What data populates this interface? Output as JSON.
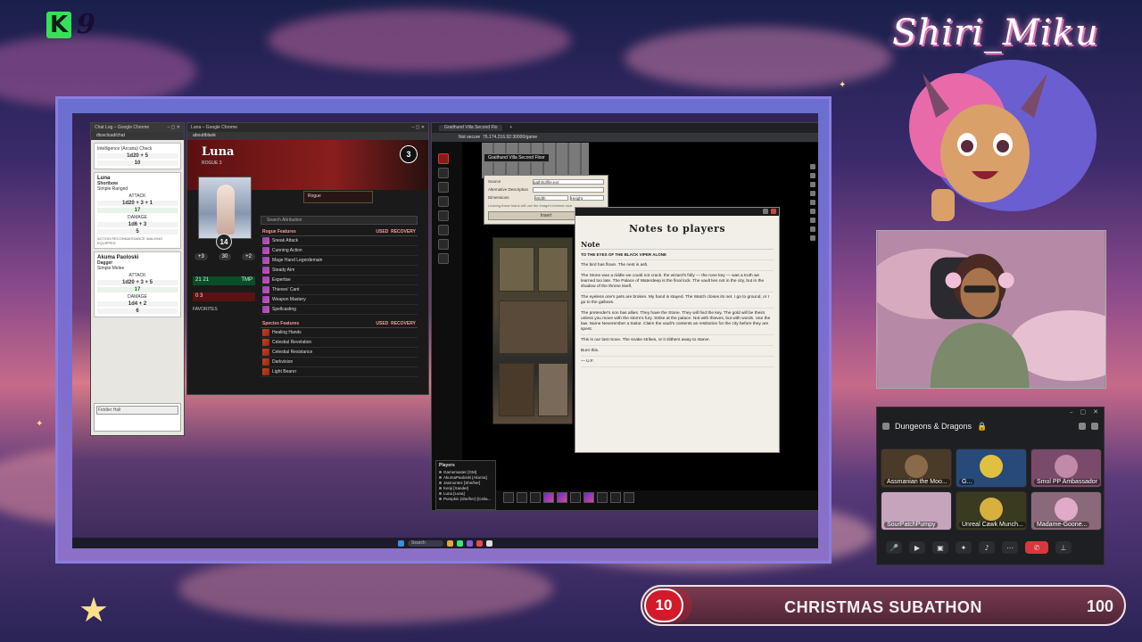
{
  "overlay": {
    "logo_letter": "K",
    "logo_number": "9",
    "streamer_name": "Shiri_Miku",
    "subathon": {
      "title": "CHRISTMAS SUBATHON",
      "current": "10",
      "goal": "100",
      "progress_fraction": 0.1,
      "accent": "#d21b2a"
    }
  },
  "chat_log": {
    "window_title": "Chat Log – Google Chrome",
    "url": "dicecloud/chat",
    "subtitle": "Intelligence (Arcana) Check",
    "first_roll": "1d20 + 5",
    "first_total": "10",
    "cards": [
      {
        "name": "Luna",
        "action": "Shortbow",
        "sub": "Simple Ranged",
        "attack_label": "ATTACK",
        "attack_formula": "1d20 + 3 + 1",
        "attack_total": "17",
        "damage_label": "DAMAGE",
        "damage_formula": "1d6 + 3",
        "damage_total": "5"
      },
      {
        "name": "Akuma Paoloski",
        "action": "Dagger",
        "sub": "Simple Melee",
        "attack_label": "ATTACK",
        "attack_formula": "1d20 + 3 + 5",
        "attack_total": "17",
        "damage_label": "DAMAGE",
        "damage_formula": "1d4 + 2",
        "damage_total": "6"
      }
    ],
    "tag_row": "ACTION   RECONNAISSANCE   WALKING   EQUIPPED",
    "select_value": "Fiddler Hall"
  },
  "sheet": {
    "window_title": "Luna – Google Chrome",
    "url": "abouttblank",
    "name": "Luna",
    "class_level": "ROGUE 3",
    "level": "3",
    "ac": "14",
    "stats": [
      "+3",
      "30",
      "+2"
    ],
    "hp": "21  21",
    "hp_extra": "TMP",
    "hit_dice": "0  3",
    "background_item": "Rogue",
    "search_placeholder": "Search Attribution",
    "favorites": "FAVORITES",
    "rogue_features_title": "Rogue Features",
    "col_used": "USED",
    "col_recovery": "RECOVERY",
    "rogue_features": [
      "Sneak Attack",
      "Cunning Action",
      "Mage Hand Legerdemain",
      "Steady Aim",
      "Expertise",
      "Thieves' Cant",
      "Weapon Mastery",
      "Spellcasting"
    ],
    "species_features_title": "Species Features",
    "species_features": [
      "Healing Hands",
      "Celestial Revelation",
      "Celestial Resistance",
      "Darkvision",
      "Light Bearer"
    ]
  },
  "foundry": {
    "tab_title": "Graithund Villa Second Flo",
    "url": "76.174.216.92:30000/game",
    "not_secure": "Not secure",
    "scene_title": "Graithund Villa Second Floor",
    "image_dialog": {
      "source_label": "Source",
      "source_value": "path/to/file.ext",
      "alt_label": "Alternative Description",
      "dim_label": "Dimensions",
      "width_label": "Width",
      "height_label": "Height",
      "hint": "Leaving these blank will use the image's intrinsic size.",
      "button": "Insert"
    },
    "notes": {
      "title": "Notes to players",
      "heading": "Note",
      "addressee": "TO THE EYES OF THE BLACK VIPER ALONE",
      "paragraphs": [
        "The bird has flown. The nest is ash.",
        "The Stone was a riddle we could not crack. the wizard's folly — the rune key — was a truth we learned too late. The Palace of Waterdeep is the final lock. The vault lies not in the city, but in the shadow of the throne itself.",
        "The eyeless one's pets are broken. My hand is stayed. The Watch closes its net. I go to ground, or I go to the gallows.",
        "The pretender's son has allies. They have the Stone. They will find the key. The gold will be theirs unless you move with the storm's fury. Strike at the palace. Not with thieves, but with words. Use the law. Name Neverember a traitor. Claim the vault's contents as restitution for the city before they are spent.",
        "This is our last move. The snake strikes, or it slithers away to starve.",
        "Burn this.",
        "— U.F."
      ]
    },
    "players_title": "Players",
    "players": [
      "Gamemaster [GM]",
      "AkumaPaoloski [Akuma]",
      "Jasmontez [She/her]",
      "Kenji [Xander]",
      "Luna [Luna]",
      "Pumpkin (she/her) [Celia..."
    ]
  },
  "discord": {
    "channel": "Dungeons & Dragons",
    "lock_icon": "lock-icon",
    "participants": [
      {
        "name": "Assmanian the Moo...",
        "color": "#4a3a28"
      },
      {
        "name": "G...",
        "color": "#274a7a"
      },
      {
        "name": "Smol PP Ambassador",
        "color": "#7a4a6a"
      },
      {
        "name": "SourPatchPumpy",
        "color": "#c6a4bc"
      },
      {
        "name": "Unreal Cawk Munch...",
        "color": "#3a3a20"
      },
      {
        "name": "Madame-Goone...",
        "color": "#8a6a7a"
      }
    ],
    "end_call_color": "#da373c"
  }
}
